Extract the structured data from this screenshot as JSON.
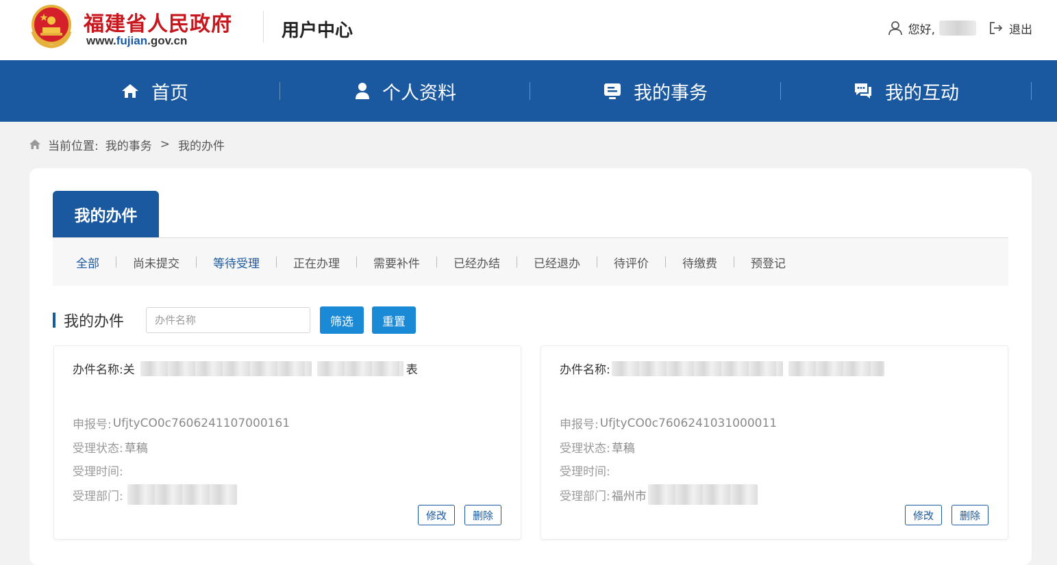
{
  "header": {
    "site_name": "福建省人民政府",
    "site_url_prefix": "www.",
    "site_url_highlight": "fujian",
    "site_url_suffix": ".gov.cn",
    "center_title": "用户中心",
    "greeting": "您好,",
    "logout_label": "退出"
  },
  "nav": {
    "items": [
      {
        "label": "首页",
        "icon": "home-icon"
      },
      {
        "label": "个人资料",
        "icon": "user-icon"
      },
      {
        "label": "我的事务",
        "icon": "task-icon"
      },
      {
        "label": "我的互动",
        "icon": "chat-icon"
      }
    ]
  },
  "breadcrumb": {
    "prefix": "当前位置:",
    "items": [
      "我的事务",
      "我的办件"
    ],
    "separator": ">"
  },
  "panel": {
    "tab_label": "我的办件",
    "filters": [
      "全部",
      "尚未提交",
      "等待受理",
      "正在办理",
      "需要补件",
      "已经办结",
      "已经退办",
      "待评价",
      "待缴费",
      "预登记"
    ],
    "section_title": "我的办件",
    "search_placeholder": "办件名称",
    "filter_button": "筛选",
    "reset_button": "重置"
  },
  "cards": [
    {
      "name_label": "办件名称:",
      "name_value": "关",
      "name_tail": "表",
      "report_label": "申报号:",
      "report_value": "UfjtyCO0c7606241107000161",
      "status_label": "受理状态:",
      "status_value": "草稿",
      "time_label": "受理时间:",
      "time_value": "",
      "dept_label": "受理部门:",
      "dept_value": "",
      "edit_label": "修改",
      "delete_label": "删除"
    },
    {
      "name_label": "办件名称:",
      "name_value": "",
      "name_tail": "",
      "report_label": "申报号:",
      "report_value": "UfjtyCO0c7606241031000011",
      "status_label": "受理状态:",
      "status_value": "草稿",
      "time_label": "受理时间:",
      "time_value": "",
      "dept_label": "受理部门:",
      "dept_value": "福州市",
      "edit_label": "修改",
      "delete_label": "删除"
    }
  ],
  "colors": {
    "brand_blue": "#1a58a0",
    "button_blue": "#1a8ad6",
    "site_red": "#c8161d"
  }
}
